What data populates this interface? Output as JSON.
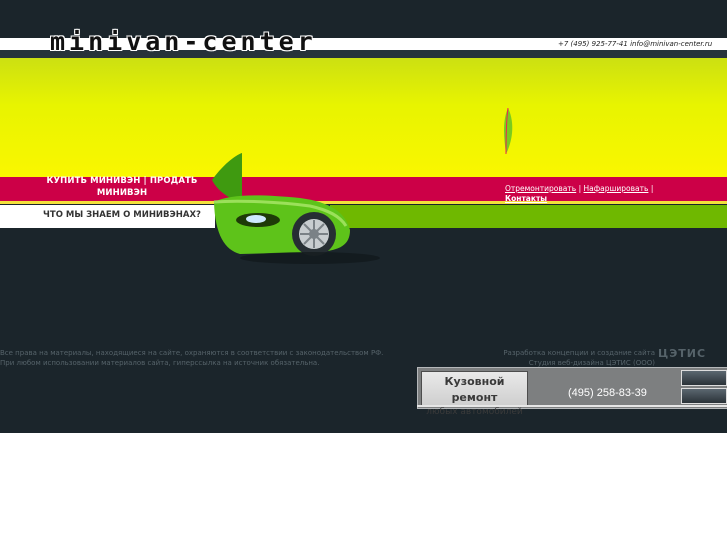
{
  "header": {
    "logo_text": "minivan-center",
    "phone": "+7 (495) 925-77-41",
    "email": "info@minivan-center.ru"
  },
  "nav": {
    "buy": "КУПИТЬ МИНИВЭН",
    "separator": "|",
    "sell": "ПРОДАТЬ МИНИВЭН",
    "about": "ЧТО МЫ ЗНАЕМ О МИНИВЭНАХ?"
  },
  "right_links": {
    "repair": "Отремонтировать",
    "stuff": "Нафаршировать",
    "contacts": "Контакты",
    "separator": "|"
  },
  "footer": {
    "rights_line1": "Все права на материалы, находящиеся на сайте, охраняются в соответствии с законодательством РФ.",
    "rights_line2": "При любом использовании материалов сайта, гиперссылка на источник обязательна.",
    "dev_line1": "Разработка концепции и создание сайта",
    "dev_line2": "Студия веб-дизайна ЦЭТИС (ООО)",
    "studio_logo": "ЦЭТИС"
  },
  "banner": {
    "title": "Кузовной ремонт",
    "subtitle": "любых автомобилей",
    "phone": "(495) 258-83-39"
  },
  "colors": {
    "background": "#1b252b",
    "magenta": "#cc0047",
    "yellow": "#faf700",
    "green": "#6fb800"
  }
}
